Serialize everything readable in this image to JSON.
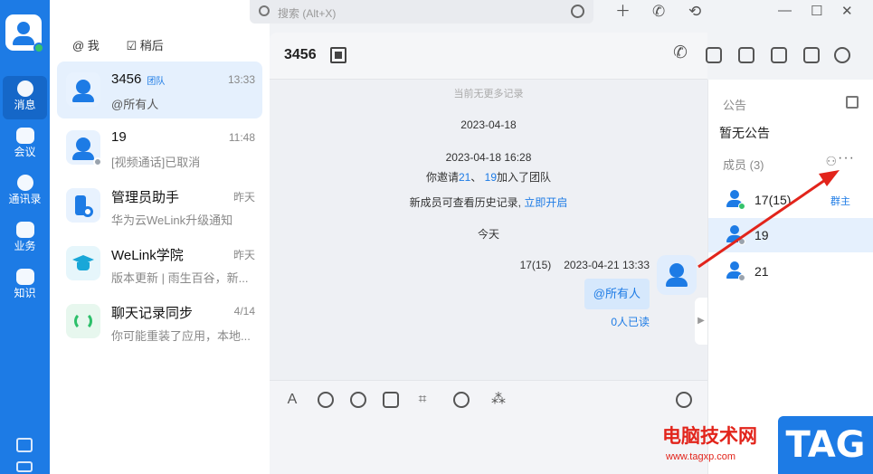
{
  "search": {
    "placeholder": "搜索 (Alt+X)"
  },
  "nav": [
    {
      "label": "消息",
      "icon": "message-icon",
      "active": true
    },
    {
      "label": "会议",
      "icon": "video-icon"
    },
    {
      "label": "通讯录",
      "icon": "contacts-icon"
    },
    {
      "label": "业务",
      "icon": "apps-icon"
    },
    {
      "label": "知识",
      "icon": "book-icon"
    }
  ],
  "filters": {
    "mention": "@ 我",
    "later": "稍后"
  },
  "conversations": [
    {
      "name": "3456",
      "tag": "团队",
      "time": "13:33",
      "snippet": "@所有人"
    },
    {
      "name": "19",
      "tag": "",
      "time": "11:48",
      "snippet": "[视频通话]已取消"
    },
    {
      "name": "管理员助手",
      "tag": "",
      "time": "昨天",
      "snippet": "华为云WeLink升级通知"
    },
    {
      "name": "WeLink学院",
      "tag": "",
      "time": "昨天",
      "snippet": "版本更新 | 雨生百谷，新..."
    },
    {
      "name": "聊天记录同步",
      "tag": "",
      "time": "4/14",
      "snippet": "你可能重装了应用，本地..."
    }
  ],
  "chat": {
    "title": "3456",
    "no_more": "当前无更多记录",
    "date1": "2023-04-18",
    "date2": "2023-04-18 16:28",
    "invite_pre": "你邀请",
    "invite_u1": "21",
    "invite_sep": "、",
    "invite_u2": "19",
    "invite_post": "加入了团队",
    "history_pre": "新成员可查看历史记录,",
    "history_link": "立即开启",
    "today": "今天",
    "sender": "17(15)",
    "sent_time": "2023-04-21 13:33",
    "message": "@所有人",
    "read": "0人已读"
  },
  "side": {
    "notice_title": "公告",
    "notice_text": "暂无公告",
    "members_title": "成员 (3)",
    "members": [
      {
        "name": "17(15)",
        "role": "群主",
        "status": "online"
      },
      {
        "name": "19",
        "role": "",
        "status": "offline"
      },
      {
        "name": "21",
        "role": "",
        "status": "offline"
      }
    ]
  },
  "watermark": {
    "text": "电脑技术网",
    "url": "www.tagxp.com",
    "logo": "TAG"
  },
  "colors": {
    "accent": "#1d7be5",
    "annotation": "#e2241b"
  }
}
